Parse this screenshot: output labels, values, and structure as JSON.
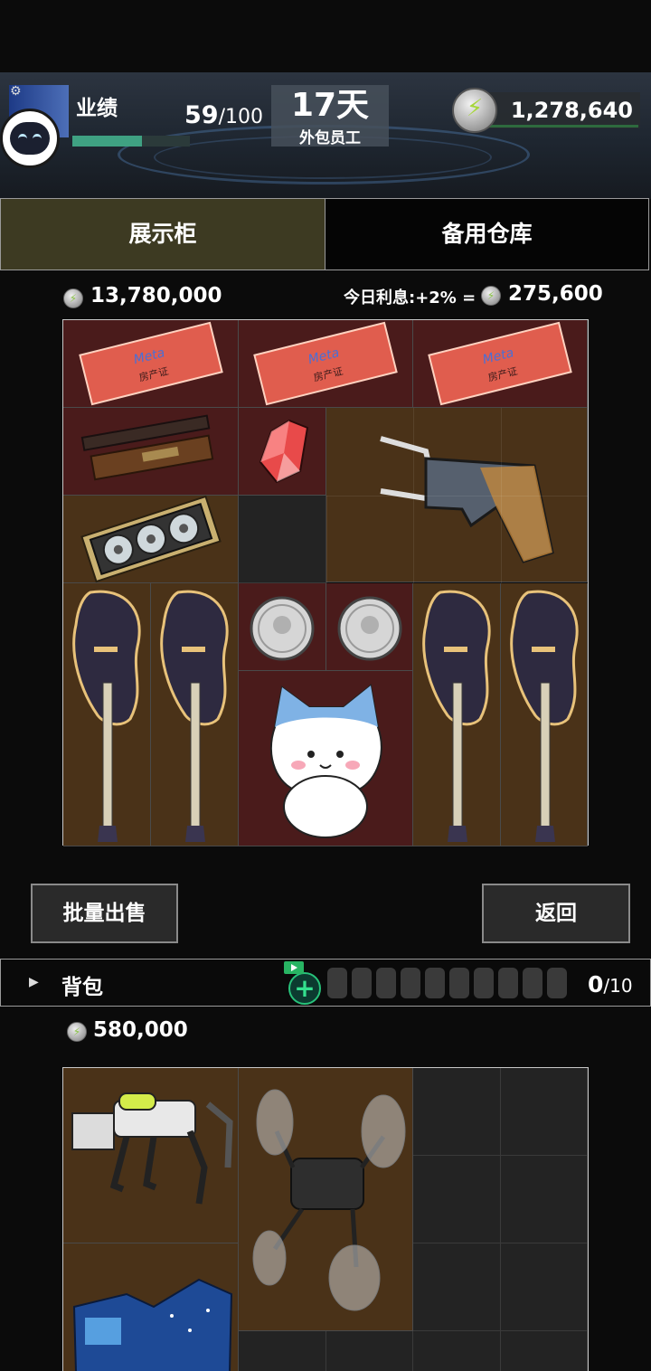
{
  "header": {
    "performance_label": "业绩",
    "performance_current": "59",
    "performance_max": "/100",
    "performance_fraction": 0.59,
    "days": "17天",
    "role": "外包员工",
    "money": "1,278,640"
  },
  "tabs": [
    {
      "label": "展示柜",
      "active": true
    },
    {
      "label": "备用仓库",
      "active": false
    }
  ],
  "showcase": {
    "total_value": "13,780,000",
    "interest_label": "今日利息:+2% =",
    "interest_value": "275,600",
    "items": [
      {
        "name": "meta-house-certificate",
        "label": "房产证",
        "brand": "Meta"
      },
      {
        "name": "meta-house-certificate",
        "label": "房产证",
        "brand": "Meta"
      },
      {
        "name": "meta-house-certificate",
        "label": "房产证",
        "brand": "Meta"
      },
      {
        "name": "wooden-box"
      },
      {
        "name": "crystal-shard"
      },
      {
        "name": "suspender-pants"
      },
      {
        "name": "graphics-card"
      },
      {
        "name": "electric-guitar"
      },
      {
        "name": "electric-guitar"
      },
      {
        "name": "silver-coin"
      },
      {
        "name": "silver-coin"
      },
      {
        "name": "electric-guitar"
      },
      {
        "name": "electric-guitar"
      },
      {
        "name": "cat-plush"
      }
    ]
  },
  "actions": {
    "sell_label": "批量出售",
    "back_label": "返回"
  },
  "backpack": {
    "label": "背包",
    "slots_used": "0",
    "slots_max": "/10",
    "total_value": "580,000",
    "items": [
      {
        "name": "robot-dog"
      },
      {
        "name": "drone"
      },
      {
        "name": "holographic-map"
      }
    ]
  },
  "colors": {
    "red_cell": "#4a1b1b",
    "brown_cell": "#4a3218",
    "empty_cell": "#232323",
    "active_tab": "#3d3a22",
    "accent_green": "#3fa182"
  },
  "icons": [
    "settings-icon",
    "avatar-robot-icon",
    "coin-icon",
    "expand-arrow-icon",
    "video-ad-icon",
    "plus-icon",
    "slot-icon"
  ]
}
